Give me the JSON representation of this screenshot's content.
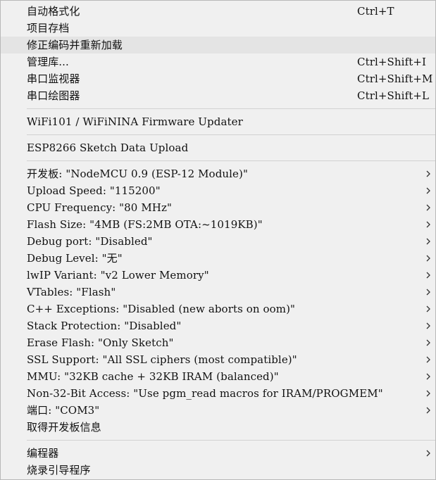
{
  "menu": {
    "items": [
      {
        "label": "自动格式化",
        "shortcut": "Ctrl+T"
      },
      {
        "label": "项目存档",
        "shortcut": ""
      },
      {
        "label": "修正编码并重新加载",
        "shortcut": "",
        "highlighted": true
      },
      {
        "label": "管理库...",
        "shortcut": "Ctrl+Shift+I"
      },
      {
        "label": "串口监视器",
        "shortcut": "Ctrl+Shift+M"
      },
      {
        "label": "串口绘图器",
        "shortcut": "Ctrl+Shift+L"
      },
      {
        "label": "WiFi101 / WiFiNINA Firmware Updater"
      },
      {
        "label": "ESP8266 Sketch Data Upload"
      },
      {
        "label": "开发板: \"NodeMCU 0.9 (ESP-12 Module)\"",
        "submenu": true
      },
      {
        "label": "Upload Speed: \"115200\"",
        "submenu": true
      },
      {
        "label": "CPU Frequency: \"80 MHz\"",
        "submenu": true
      },
      {
        "label": "Flash Size: \"4MB (FS:2MB OTA:~1019KB)\"",
        "submenu": true
      },
      {
        "label": "Debug port: \"Disabled\"",
        "submenu": true
      },
      {
        "label": "Debug Level: \"无\"",
        "submenu": true
      },
      {
        "label": "lwIP Variant: \"v2 Lower Memory\"",
        "submenu": true
      },
      {
        "label": "VTables: \"Flash\"",
        "submenu": true
      },
      {
        "label": "C++ Exceptions: \"Disabled (new aborts on oom)\"",
        "submenu": true
      },
      {
        "label": "Stack Protection: \"Disabled\"",
        "submenu": true
      },
      {
        "label": "Erase Flash: \"Only Sketch\"",
        "submenu": true
      },
      {
        "label": "SSL Support: \"All SSL ciphers (most compatible)\"",
        "submenu": true
      },
      {
        "label": "MMU: \"32KB cache + 32KB IRAM (balanced)\"",
        "submenu": true
      },
      {
        "label": "Non-32-Bit Access: \"Use pgm_read macros for IRAM/PROGMEM\"",
        "submenu": true
      },
      {
        "label": "端口: \"COM3\"",
        "submenu": true
      },
      {
        "label": "取得开发板信息"
      },
      {
        "label": "编程器",
        "submenu": true
      },
      {
        "label": "烧录引导程序"
      }
    ]
  },
  "colors": {
    "background": "#f0f0f0",
    "highlight": "#e4e4e4",
    "separator": "#d2d2d2",
    "text": "#111111"
  },
  "icons": {
    "submenu_arrow": "chevron-right-icon"
  }
}
